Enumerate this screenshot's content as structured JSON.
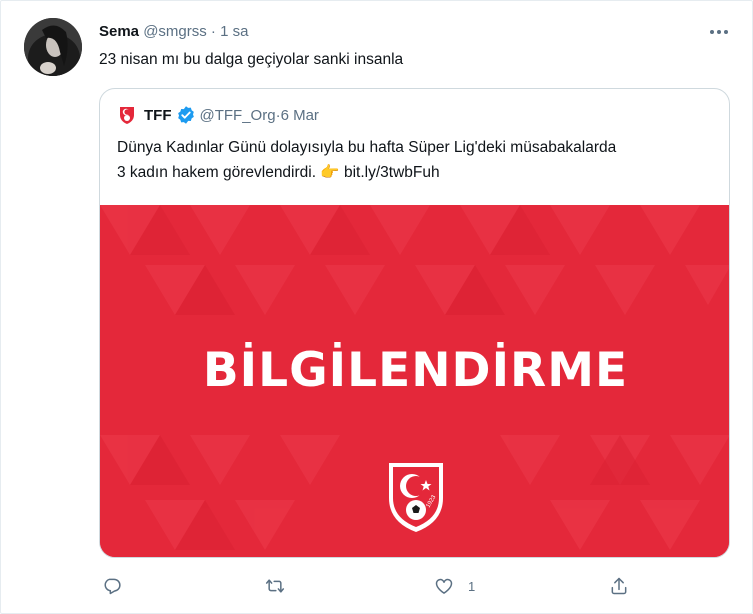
{
  "tweet": {
    "author_name": "Sema",
    "handle": "@smgrss",
    "separator": " · ",
    "time": "1 sa",
    "text": "23 nisan mı bu dalga geçiyolar sanki insanla"
  },
  "quoted": {
    "author_name": "TFF",
    "handle": "@TFF_Org",
    "separator": " · ",
    "date": "6 Mar",
    "text_line1": "Dünya Kadınlar Günü dolayısıyla bu hafta Süper Lig'deki müsabakalarda",
    "text_line2": "3 kadın hakem görevlendirdi. ",
    "emoji": "👉",
    "link": " bit.ly/3twbFuh",
    "image_title": "BİLGİLENDİRME",
    "emblem_year": "1923"
  },
  "actions": {
    "reply_count": "",
    "retweet_count": "",
    "like_count": "1",
    "share_count": ""
  },
  "colors": {
    "banner_red": "#e4283a",
    "verified_blue": "#1d9bf0",
    "meta_gray": "#5b7083"
  }
}
